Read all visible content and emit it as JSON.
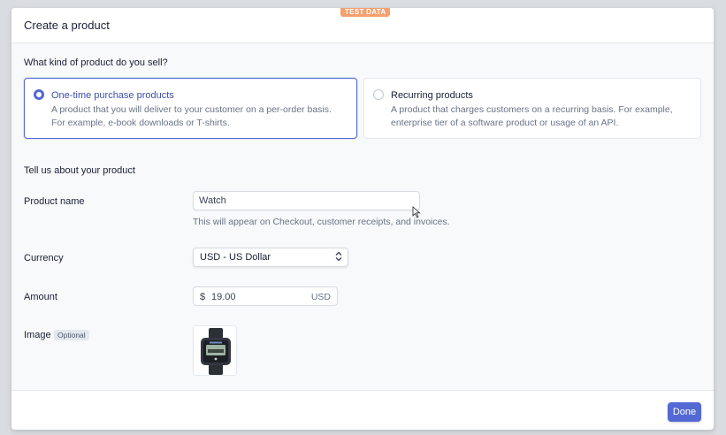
{
  "badge": {
    "test_data": "TEST DATA"
  },
  "modal": {
    "title": "Create a product"
  },
  "product_type": {
    "question": "What kind of product do you sell?",
    "options": [
      {
        "title": "One-time purchase products",
        "description": "A product that you will deliver to your customer on a per-order basis. For example, e-book downloads or T-shirts.",
        "selected": true
      },
      {
        "title": "Recurring products",
        "description": "A product that charges customers on a recurring basis. For example, enterprise tier of a software product or usage of an API.",
        "selected": false
      }
    ]
  },
  "details": {
    "section_title": "Tell us about your product",
    "product_name": {
      "label": "Product name",
      "value": "Watch",
      "hint": "This will appear on Checkout, customer receipts, and invoices."
    },
    "currency": {
      "label": "Currency",
      "value": "USD - US Dollar"
    },
    "amount": {
      "label": "Amount",
      "prefix": "$",
      "value": "19.00",
      "suffix": "USD"
    },
    "image": {
      "label": "Image",
      "badge": "Optional"
    }
  },
  "footer": {
    "done_label": "Done"
  },
  "colors": {
    "accent": "#5469d4",
    "badge": "#f5a06f"
  }
}
